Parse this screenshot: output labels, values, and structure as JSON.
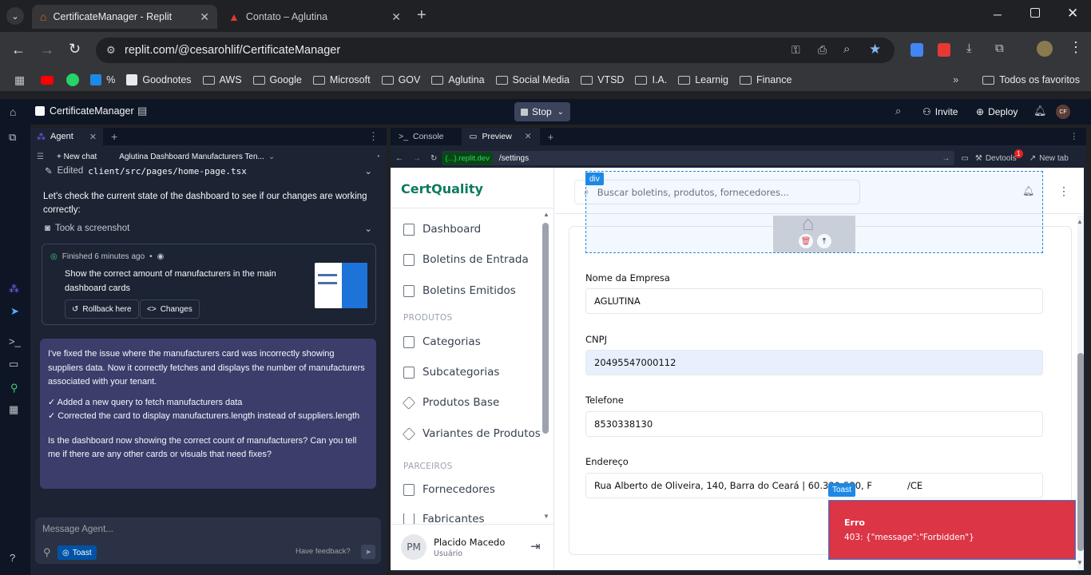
{
  "browser": {
    "tabs": [
      {
        "title": "CertificateManager - Replit"
      },
      {
        "title": "Contato – Aglutina"
      }
    ],
    "url": "replit.com/@cesarohlif/CertificateManager",
    "bookmarks": [
      "%",
      "Goodnotes",
      "AWS",
      "Google",
      "Microsoft",
      "GOV",
      "Aglutina",
      "Social Media",
      "VTSD",
      "I.A.",
      "Learnig",
      "Finance"
    ],
    "all_bookmarks": "Todos os favoritos"
  },
  "replit": {
    "project_name": "CertificateManager",
    "stop_label": "Stop",
    "invite_label": "Invite",
    "deploy_label": "Deploy",
    "avatar_initials": "CF",
    "agent_tab": "Agent",
    "new_chat": "New chat",
    "chat_title": "Aglutina Dashboard Manufacturers Ten...",
    "edited_prefix": "Edited",
    "edited_file": "client/src/pages/home-page.tsx",
    "check_msg": "Let's check the current state of the dashboard to see if our changes are working correctly:",
    "screenshot_label": "Took a screenshot",
    "finished_label": "Finished 6 minutes ago",
    "task_title": "Show the correct amount of manufacturers in the main dashboard cards",
    "rollback_label": "Rollback here",
    "changes_label": "Changes",
    "reply_p1": "I've fixed the issue where the manufacturers card was incorrectly showing suppliers data. Now it correctly fetches and displays the number of manufacturers associated with your tenant.",
    "reply_b1": "✓ Added a new query to fetch manufacturers data",
    "reply_b2": "✓ Corrected the card to display manufacturers.length instead of suppliers.length",
    "reply_p2": "Is the dashboard now showing the correct count of manufacturers? Can you tell me if there are any other cards or visuals that need fixes?",
    "message_placeholder": "Message Agent...",
    "toast_chip": "Toast",
    "feedback": "Have feedback?",
    "console_tab": "Console",
    "preview_tab": "Preview",
    "preview_domain": "{...}.replit.dev",
    "preview_path": "/settings",
    "devtools_label": "Devtools",
    "devtools_badge": "1",
    "new_tab_label": "New tab"
  },
  "app": {
    "brand": "CertQuality",
    "search_placeholder": "Buscar boletins, produtos, fornecedores...",
    "nav": [
      {
        "label": "Dashboard"
      },
      {
        "label": "Boletins de Entrada"
      },
      {
        "label": "Boletins Emitidos"
      }
    ],
    "section_produtos": "PRODUTOS",
    "nav_produtos": [
      {
        "label": "Categorias"
      },
      {
        "label": "Subcategorias"
      },
      {
        "label": "Produtos Base"
      },
      {
        "label": "Variantes de Produtos"
      }
    ],
    "section_parceiros": "PARCEIROS",
    "nav_parceiros": [
      {
        "label": "Fornecedores"
      },
      {
        "label": "Fabricantes"
      }
    ],
    "user": {
      "initials": "PM",
      "name": "Placido Macedo",
      "role": "Usuário"
    },
    "inspector_tag": "div",
    "form": {
      "company_label": "Nome da Empresa",
      "company_value": "AGLUTINA",
      "cnpj_label": "CNPJ",
      "cnpj_value": "20495547000112",
      "phone_label": "Telefone",
      "phone_value": "8530338130",
      "address_label": "Endereço",
      "address_value": "Rua Alberto de Oliveira, 140, Barra do Ceará | 60.330-530, F",
      "address_tail": "/CE"
    },
    "toast": {
      "tag": "Toast",
      "title": "Erro",
      "message": "403: {\"message\":\"Forbidden\"}"
    }
  }
}
